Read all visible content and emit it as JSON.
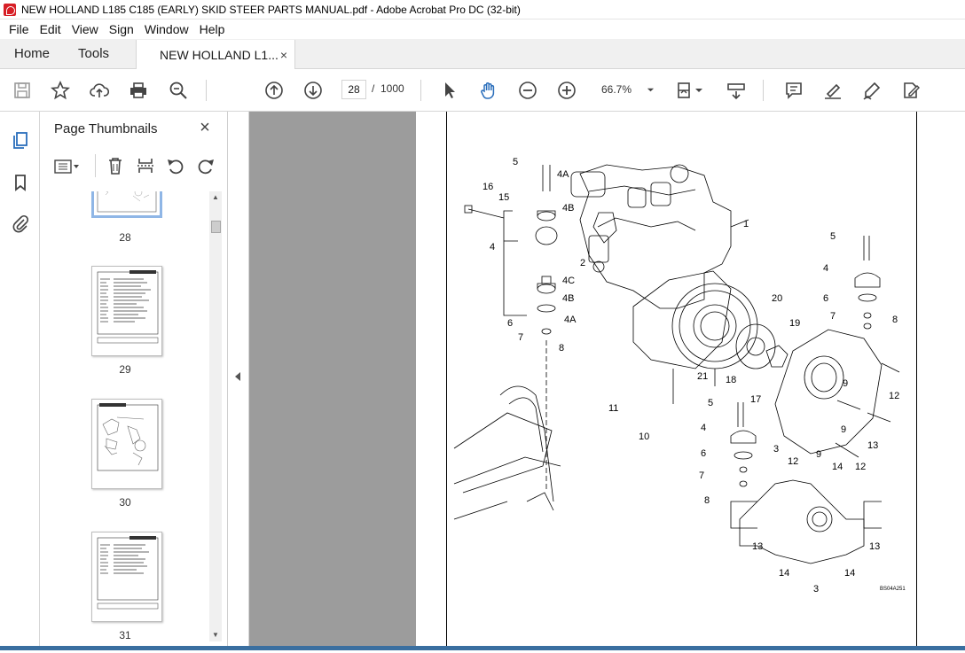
{
  "window": {
    "title": "NEW HOLLAND L185 C185 (EARLY) SKID STEER  PARTS MANUAL.pdf - Adobe Acrobat Pro DC (32-bit)"
  },
  "menu": [
    "File",
    "Edit",
    "View",
    "Sign",
    "Window",
    "Help"
  ],
  "tabs": {
    "home": "Home",
    "tools": "Tools",
    "document": "NEW HOLLAND L1...",
    "close": "×"
  },
  "toolbar": {
    "current_page": "28",
    "page_separator": "/",
    "total_pages": "1000",
    "zoom": "66.7%"
  },
  "thumbnails_panel": {
    "title": "Page Thumbnails",
    "close": "×",
    "pages": [
      {
        "label": "28",
        "selected": true
      },
      {
        "label": "29",
        "selected": false
      },
      {
        "label": "30",
        "selected": false
      },
      {
        "label": "31",
        "selected": false
      }
    ]
  },
  "diagram": {
    "callouts": [
      "1",
      "2",
      "3",
      "3",
      "3",
      "4",
      "4",
      "4A",
      "4A",
      "4B",
      "4B",
      "4C",
      "5",
      "5",
      "5",
      "6",
      "6",
      "6",
      "7",
      "7",
      "7",
      "8",
      "8",
      "8",
      "9",
      "9",
      "9",
      "10",
      "11",
      "12",
      "12",
      "12",
      "13",
      "13",
      "13",
      "14",
      "14",
      "14",
      "15",
      "16",
      "17",
      "18",
      "19",
      "20",
      "21"
    ],
    "figure_code": "BS04A251"
  },
  "colors": {
    "accent_blue": "#2a6ebb",
    "doc_gray": "#9c9c9c",
    "acrobat_red": "#d71f26"
  }
}
